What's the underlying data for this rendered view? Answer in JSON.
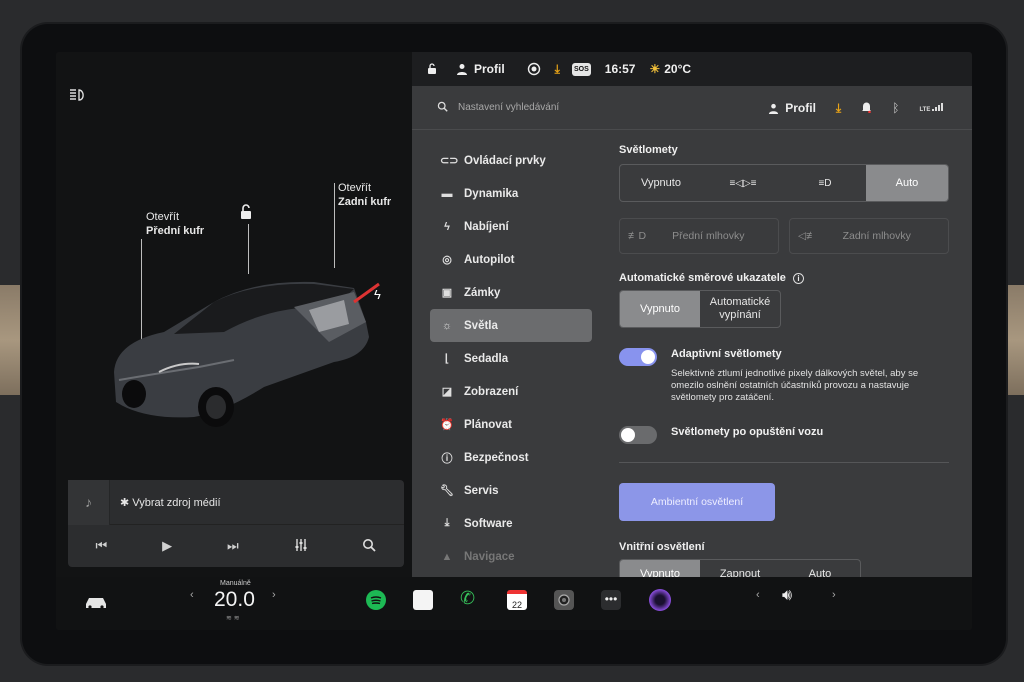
{
  "topbar": {
    "profile": "Profil",
    "time": "16:57",
    "temp": "20°C",
    "sos": "SOS"
  },
  "search": {
    "placeholder": "Nastavení vyhledávání",
    "profile": "Profil",
    "lte": "LTE"
  },
  "car": {
    "front_action": "Otevřít",
    "front_label": "Přední kufr",
    "rear_action": "Otevřít",
    "rear_label": "Zadní kufr"
  },
  "media": {
    "source": "Vybrat zdroj médií"
  },
  "nav": [
    {
      "label": "Ovládací prvky",
      "icon": "toggle-icon"
    },
    {
      "label": "Dynamika",
      "icon": "car-icon"
    },
    {
      "label": "Nabíjení",
      "icon": "bolt-icon"
    },
    {
      "label": "Autopilot",
      "icon": "steering-wheel-icon"
    },
    {
      "label": "Zámky",
      "icon": "lock-icon"
    },
    {
      "label": "Světla",
      "icon": "sun-icon"
    },
    {
      "label": "Sedadla",
      "icon": "seat-icon"
    },
    {
      "label": "Zobrazení",
      "icon": "display-icon"
    },
    {
      "label": "Plánovat",
      "icon": "alarm-icon"
    },
    {
      "label": "Bezpečnost",
      "icon": "alert-icon"
    },
    {
      "label": "Servis",
      "icon": "wrench-icon"
    },
    {
      "label": "Software",
      "icon": "download-icon"
    },
    {
      "label": "Navigace",
      "icon": "navigation-icon"
    }
  ],
  "lights": {
    "headlights_title": "Světlomety",
    "headlights_options": [
      "Vypnuto",
      "",
      "",
      "Auto"
    ],
    "front_fog": "Přední mlhovky",
    "rear_fog": "Zadní mlhovky",
    "turn_title": "Automatické směrové ukazatele",
    "turn_options": [
      "Vypnuto",
      "Automatické vypínání"
    ],
    "adaptive_label": "Adaptivní světlomety",
    "adaptive_desc": "Selektivně ztlumí jednotlivé pixely dálkových světel, aby se omezilo oslnění ostatních účastníků provozu a nastavuje světlomety pro zatáčení.",
    "after_exit_label": "Světlomety po opuštění vozu",
    "ambient_button": "Ambientní osvětlení",
    "interior_title": "Vnitřní osvětlení",
    "interior_options": [
      "Vypnuto",
      "Zapnout",
      "Auto"
    ]
  },
  "climate": {
    "mode": "Manuálně",
    "temp": "20.0"
  },
  "calendar_day": "22",
  "accent": "#8893ee"
}
